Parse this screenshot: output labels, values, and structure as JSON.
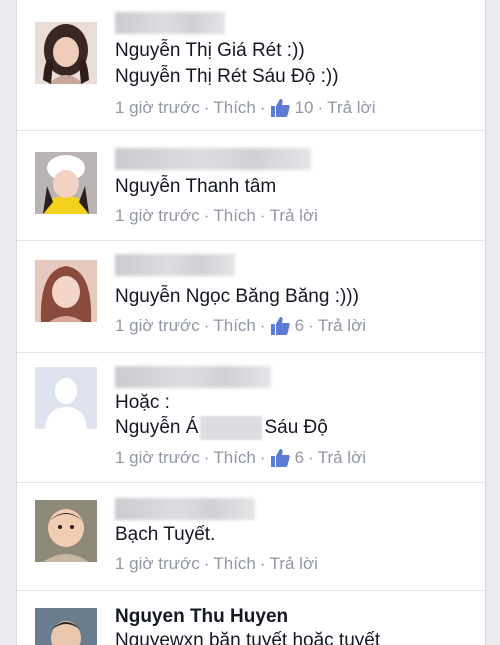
{
  "comments": [
    {
      "author": "",
      "lines": [
        "Nguyễn Thị Giá Rét :))",
        "Nguyễn Thị Rét Sáu Độ :))"
      ],
      "time": "1 giờ trước",
      "like_label": "Thích",
      "like_count": "10",
      "reply_label": "Trả lời"
    },
    {
      "author": "",
      "lines": [
        "Nguyễn Thanh tâm"
      ],
      "time": "1 giờ trước",
      "like_label": "Thích",
      "reply_label": "Trả lời"
    },
    {
      "author": "",
      "lines": [
        "Nguyễn Ngọc Băng Băng :)))"
      ],
      "time": "1 giờ trước",
      "like_label": "Thích",
      "like_count": "6",
      "reply_label": "Trả lời"
    },
    {
      "author": "",
      "lines": [
        "Hoặc :"
      ],
      "line2_prefix": "Nguyễn Á",
      "line2_suffix": "Sáu Độ",
      "time": "1 giờ trước",
      "like_label": "Thích",
      "like_count": "6",
      "reply_label": "Trả lời"
    },
    {
      "author": "",
      "lines": [
        "Bạch Tuyết."
      ],
      "time": "1 giờ trước",
      "like_label": "Thích",
      "reply_label": "Trả lời"
    },
    {
      "author": "Nguyen Thu Huyen",
      "lines": [
        "Nguyewxn băn tuyết hoặc tuyết"
      ]
    }
  ],
  "separator": "·",
  "icons": {
    "like": "thumbs-up-icon",
    "default_avatar": "default-avatar-icon"
  },
  "colors": {
    "link": "#9197a3",
    "like_blue": "#5b7bd5",
    "text": "#141823"
  }
}
